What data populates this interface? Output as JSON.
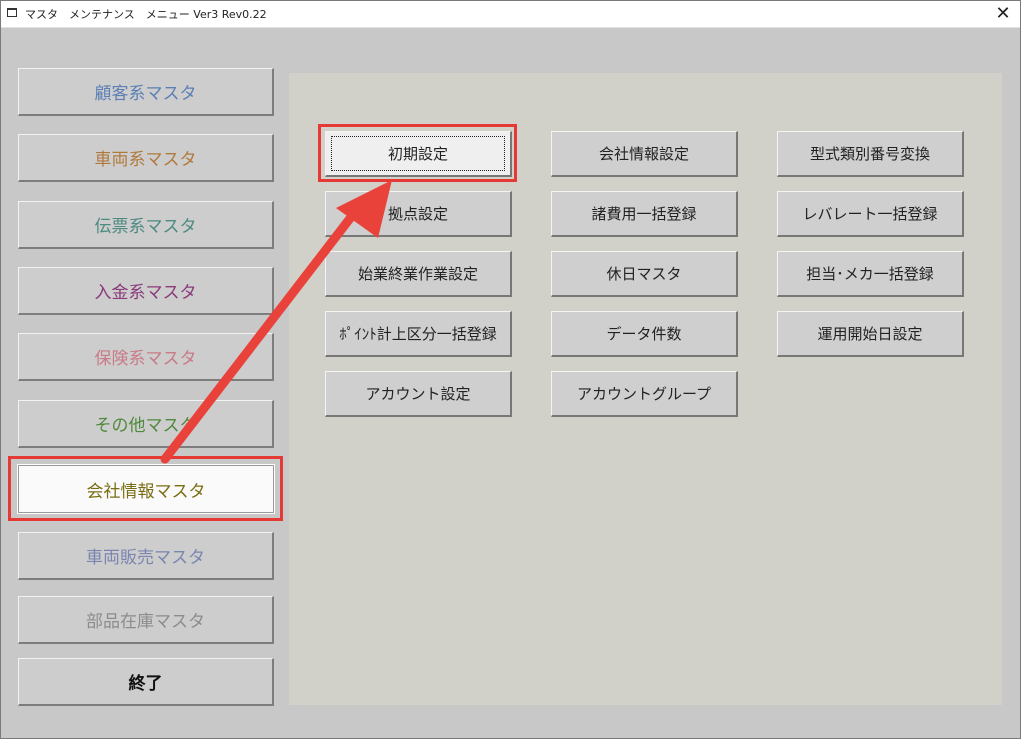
{
  "window": {
    "title": "マスタ　メンテナンス　メニュー Ver3 Rev0.22",
    "close_glyph": "✕"
  },
  "sidebar": {
    "items": [
      {
        "label": "顧客系マスタ",
        "color": "#5b7fb5"
      },
      {
        "label": "車両系マスタ",
        "color": "#b07a3c"
      },
      {
        "label": "伝票系マスタ",
        "color": "#4d8a82"
      },
      {
        "label": "入金系マスタ",
        "color": "#8a3a7a"
      },
      {
        "label": "保険系マスタ",
        "color": "#c97a86"
      },
      {
        "label": "その他マスタ",
        "color": "#4f8a3c"
      },
      {
        "label": "会社情報マスタ",
        "color": "#7a6e12",
        "selected": true
      },
      {
        "label": "車両販売マスタ",
        "color": "#7a86b0"
      },
      {
        "label": "部品在庫マスタ",
        "color": "#8c8c8c"
      },
      {
        "label": "終了",
        "color": "#111111"
      }
    ]
  },
  "panel": {
    "buttons": [
      {
        "label": "初期設定"
      },
      {
        "label": "会社情報設定"
      },
      {
        "label": "型式類別番号変換"
      },
      {
        "label": "拠点設定"
      },
      {
        "label": "諸費用一括登録"
      },
      {
        "label": "レバレート一括登録"
      },
      {
        "label": "始業終業作業設定"
      },
      {
        "label": "休日マスタ"
      },
      {
        "label": "担当･メカ一括登録"
      },
      {
        "label": "ﾎﾟｲﾝﾄ計上区分一括登録"
      },
      {
        "label": "データ件数"
      },
      {
        "label": "運用開始日設定"
      },
      {
        "label": "アカウント設定"
      },
      {
        "label": "アカウントグループ"
      }
    ]
  },
  "annotation": {
    "color": "#e8423b"
  }
}
